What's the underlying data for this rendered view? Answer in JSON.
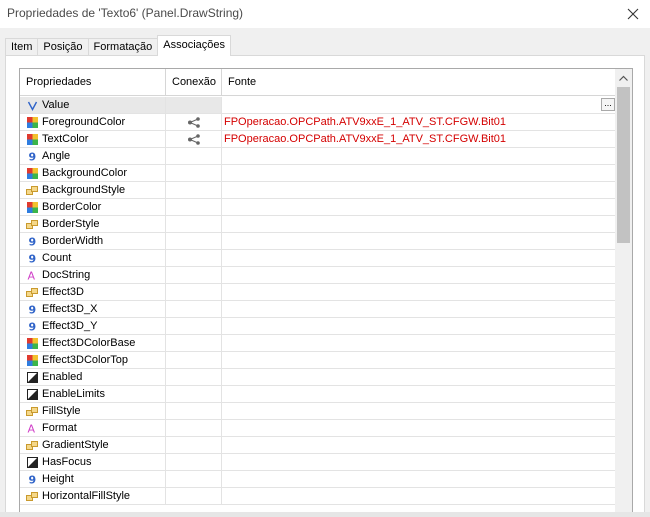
{
  "window": {
    "title": "Propriedades de 'Texto6' (Panel.DrawString)"
  },
  "tabs": [
    {
      "label": "Item"
    },
    {
      "label": "Posição"
    },
    {
      "label": "Formatação"
    },
    {
      "label": "Associações",
      "active": true
    }
  ],
  "grid": {
    "headers": {
      "property": "Propriedades",
      "connection": "Conexão",
      "source": "Fonte"
    },
    "rows": [
      {
        "name": "Value",
        "icon": "value-v-icon",
        "connection": false,
        "source": "",
        "has_browse": true,
        "browse_label": "..."
      },
      {
        "name": "ForegroundColor",
        "icon": "color-palette-icon",
        "connection": true,
        "source": "FPOperacao.OPCPath.ATV9xxE_1_ATV_ST.CFGW.Bit01"
      },
      {
        "name": "TextColor",
        "icon": "color-palette-icon",
        "connection": true,
        "source": "FPOperacao.OPCPath.ATV9xxE_1_ATV_ST.CFGW.Bit01"
      },
      {
        "name": "Angle",
        "icon": "numeric-9-icon",
        "connection": false,
        "source": ""
      },
      {
        "name": "BackgroundColor",
        "icon": "color-palette-icon",
        "connection": false,
        "source": ""
      },
      {
        "name": "BackgroundStyle",
        "icon": "enum-icon",
        "connection": false,
        "source": ""
      },
      {
        "name": "BorderColor",
        "icon": "color-palette-icon",
        "connection": false,
        "source": ""
      },
      {
        "name": "BorderStyle",
        "icon": "enum-icon",
        "connection": false,
        "source": ""
      },
      {
        "name": "BorderWidth",
        "icon": "numeric-9-icon",
        "connection": false,
        "source": ""
      },
      {
        "name": "Count",
        "icon": "numeric-9-icon",
        "connection": false,
        "source": ""
      },
      {
        "name": "DocString",
        "icon": "text-a-icon",
        "connection": false,
        "source": ""
      },
      {
        "name": "Effect3D",
        "icon": "enum-icon",
        "connection": false,
        "source": ""
      },
      {
        "name": "Effect3D_X",
        "icon": "numeric-9-icon",
        "connection": false,
        "source": ""
      },
      {
        "name": "Effect3D_Y",
        "icon": "numeric-9-icon",
        "connection": false,
        "source": ""
      },
      {
        "name": "Effect3DColorBase",
        "icon": "color-palette-icon",
        "connection": false,
        "source": ""
      },
      {
        "name": "Effect3DColorTop",
        "icon": "color-palette-icon",
        "connection": false,
        "source": ""
      },
      {
        "name": "Enabled",
        "icon": "boolean-icon",
        "connection": false,
        "source": ""
      },
      {
        "name": "EnableLimits",
        "icon": "boolean-icon",
        "connection": false,
        "source": ""
      },
      {
        "name": "FillStyle",
        "icon": "enum-icon",
        "connection": false,
        "source": ""
      },
      {
        "name": "Format",
        "icon": "text-a-icon",
        "connection": false,
        "source": ""
      },
      {
        "name": "GradientStyle",
        "icon": "enum-icon",
        "connection": false,
        "source": ""
      },
      {
        "name": "HasFocus",
        "icon": "boolean-icon",
        "connection": false,
        "source": ""
      },
      {
        "name": "Height",
        "icon": "numeric-9-icon",
        "connection": false,
        "source": ""
      },
      {
        "name": "HorizontalFillStyle",
        "icon": "enum-icon",
        "connection": false,
        "source": ""
      }
    ]
  },
  "colors": {
    "source_text": "#d40000",
    "numeric_icon": "#2f63c8",
    "text_icon": "#d040c8",
    "enum_icon": "#c99a2e"
  }
}
